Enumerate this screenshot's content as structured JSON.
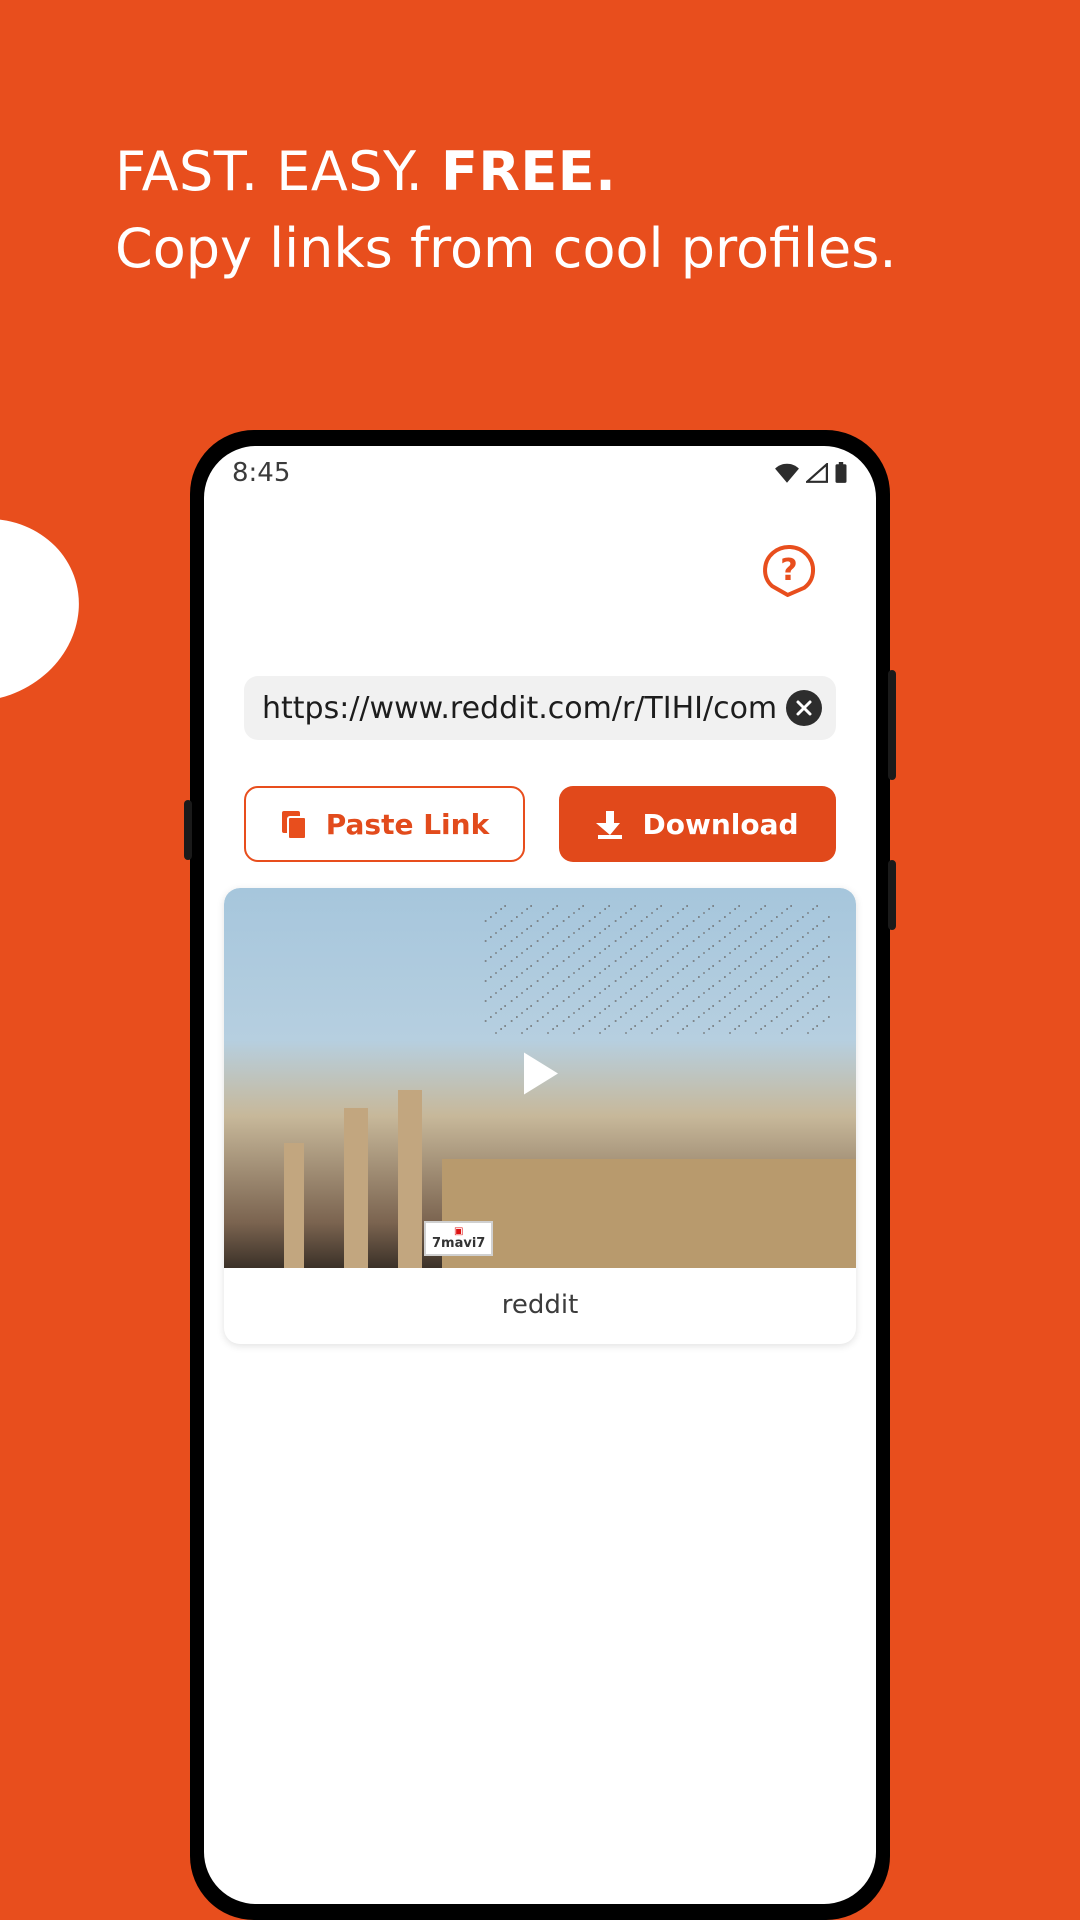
{
  "colors": {
    "brand": "#e84e1d",
    "brand_dark": "#e1491b"
  },
  "hero": {
    "line1_pre": "FAST. EASY. ",
    "line1_emph": "FREE.",
    "subtitle": "Copy links from cool profiles."
  },
  "status": {
    "time": "8:45"
  },
  "url": {
    "value": "https://www.reddit.com/r/TIHI/comr"
  },
  "buttons": {
    "paste": "Paste Link",
    "download": "Download"
  },
  "preview": {
    "source_label": "reddit",
    "watermark": "7mavi7"
  }
}
